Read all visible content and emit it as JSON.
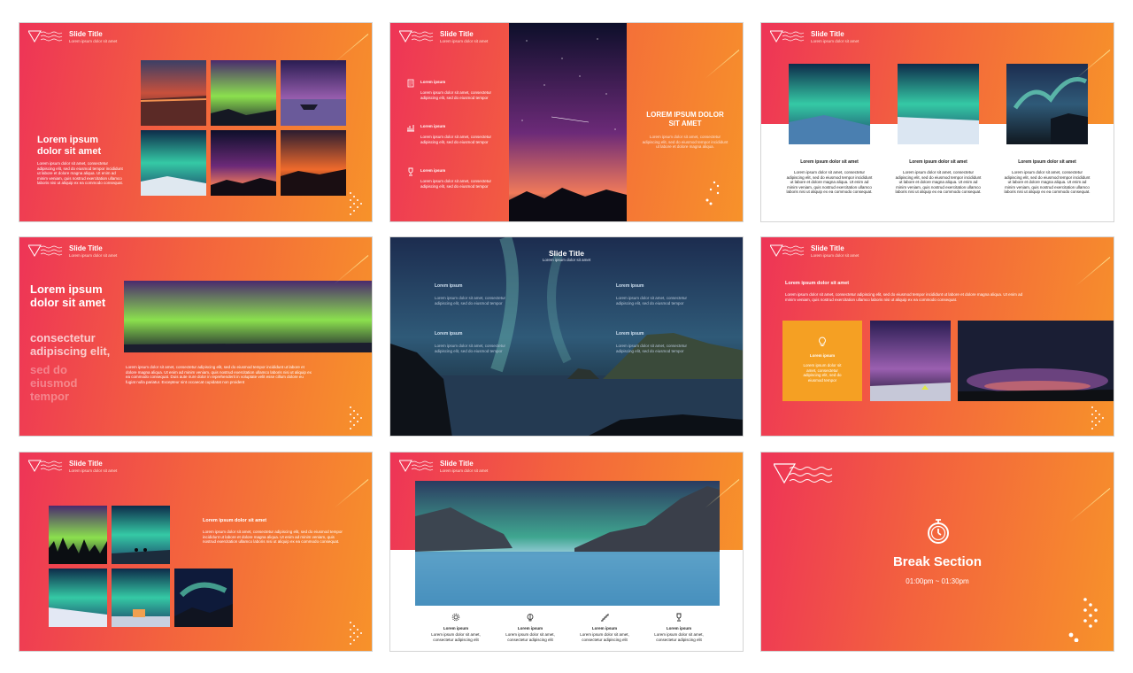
{
  "common": {
    "slide_title": "Slide Title",
    "slide_sub": "Lorem ipsum dolor sit amet",
    "lorem": "Lorem ipsum",
    "short_body": "Lorem ipsum dolor sit amet, consectetur adipiscing elit, sed do eiusmod tempor"
  },
  "s1": {
    "heading": "Lorem ipsum dolor sit amet",
    "body": "Lorem ipsum dolor sit amet, consectetur adipiscing elit, sed do eiusmod tempor incididunt ut labore et dolore magna aliqua. Ut enim ad minim veniam, quis nostrud exercitation ullamco laboris nisi ut aliquip ex ea commodo consequat."
  },
  "s2": {
    "heading": "LOREM IPSUM DOLOR SIT AMET",
    "body": "Lorem ipsum dolor sit amet, consectetur adipiscing elit, sed do eiusmod tempor incididunt ut labore et dolore magna aliqua."
  },
  "s3": {
    "col_title": "Lorem ipsum dolor sit amet",
    "col_body": "Lorem ipsum dolor sit amet, consectetur adipiscing elit, sed do eiusmod tempor incididunt ut labore et dolore magna aliqua. Ut enim ad minim veniam, quis nostrud exercitation ullamco laboris nisi ut aliquip ex ea commodo consequat."
  },
  "s4": {
    "big_white": "Lorem ipsum dolor sit amet",
    "big_faded": "consectetur adipiscing elit,",
    "big_faded2": "sed do eiusmod tempor",
    "body": "Lorem ipsum dolor sit amet, consectetur adipiscing elit, sed do eiusmod tempor incididunt ut labore et dolore magna aliqua. Ut enim ad minim veniam, quis nostrud exercitation ullamco laboris nisi ut aliquip ex ea commodo consequat. Duis aute irure dolor in reprehenderit in voluptate velit esse cillum dolore eu fugiat nulla pariatur. Excepteur sint occaecat cupidatat non proident"
  },
  "s6": {
    "heading": "Lorem ipsum dolor sit amet",
    "body": "Lorem ipsum dolor sit amet, consectetur adipiscing elit, sed do eiusmod tempor incididunt ut labore et dolore magna aliqua. Ut enim ad minim veniam, quis nostrud exercitation ullamco laboris nisi ut aliquip ex ea commodo consequat.",
    "card_body": "Lorem ipsum dolor sit amet, consectetur adipiscing elit, sed do eiusmod tempor"
  },
  "s7": {
    "heading": "Lorem ipsum dolor sit amet",
    "body": "Lorem ipsum dolor sit amet, consectetur adipiscing elit, sed do eiusmod tempor incididunt ut labore et dolore magna aliqua. Ut enim ad minim veniam, quis nostrud exercitation ullamco laboris nisi ut aliquip ex ea commodo consequat."
  },
  "s8": {
    "item_body": "Lorem ipsum dolor sit amet, consectetur adipiscing elit"
  },
  "s9": {
    "title": "Break Section",
    "time": "01:00pm ~ 01:30pm"
  },
  "colors": {
    "grad_start": "#ee3457",
    "grad_end": "#f7922a",
    "card_orange": "#f5a023",
    "icon_stroke": "#ffffff"
  },
  "icons": [
    "document-icon",
    "bar-chart-icon",
    "trophy-icon",
    "stopwatch-icon",
    "lightbulb-icon",
    "gear-icon",
    "stairs-icon",
    "brain-icon"
  ]
}
